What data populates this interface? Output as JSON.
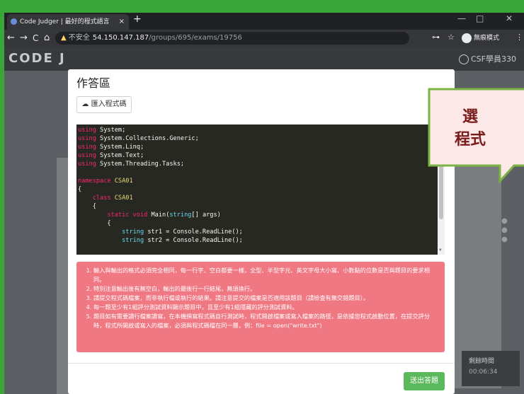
{
  "browser": {
    "tab_title": "Code Judger | 最好的程式語言",
    "tab_close": "×",
    "new_tab": "+",
    "win_min": "—",
    "win_max": "□",
    "win_close": "✕",
    "back": "←",
    "forward": "→",
    "reload": "C",
    "home": "⌂",
    "security_label": "不安全",
    "url_host": "54.150.147.187",
    "url_path": "/groups/695/exams/19756",
    "key_icon": "⊶",
    "star_icon": "☆",
    "incognito_label": "無痕模式",
    "menu_icon": "⋮"
  },
  "site": {
    "logo": "CODE J",
    "user": "CSF學員330"
  },
  "modal": {
    "title": "作答區",
    "import_button": "匯入程式碼",
    "submit_button": "送出答題"
  },
  "code_lines": [
    [
      {
        "t": "using",
        "c": "kw"
      },
      {
        "t": " System;",
        "c": ""
      }
    ],
    [
      {
        "t": "using",
        "c": "kw"
      },
      {
        "t": " System.Collections.Generic;",
        "c": ""
      }
    ],
    [
      {
        "t": "using",
        "c": "kw"
      },
      {
        "t": " System.Linq;",
        "c": ""
      }
    ],
    [
      {
        "t": "using",
        "c": "kw"
      },
      {
        "t": " System.Text;",
        "c": ""
      }
    ],
    [
      {
        "t": "using",
        "c": "kw"
      },
      {
        "t": " System.Threading.Tasks;",
        "c": ""
      }
    ],
    [],
    [
      {
        "t": "namespace",
        "c": "kw"
      },
      {
        "t": " CSA01",
        "c": "cls"
      }
    ],
    [
      {
        "t": "{",
        "c": ""
      }
    ],
    [
      {
        "t": "    class",
        "c": "kw"
      },
      {
        "t": " CSA01",
        "c": "cls"
      }
    ],
    [
      {
        "t": "    {",
        "c": ""
      }
    ],
    [
      {
        "t": "        static",
        "c": "kw"
      },
      {
        "t": " ",
        "c": ""
      },
      {
        "t": "void",
        "c": "kw"
      },
      {
        "t": " Main(",
        "c": ""
      },
      {
        "t": "string",
        "c": "ty"
      },
      {
        "t": "[] args)",
        "c": ""
      }
    ],
    [
      {
        "t": "        {",
        "c": ""
      }
    ],
    [
      {
        "t": "            ",
        "c": ""
      },
      {
        "t": "string",
        "c": "ty"
      },
      {
        "t": " str1 = Console.ReadLine();",
        "c": ""
      }
    ],
    [
      {
        "t": "            ",
        "c": ""
      },
      {
        "t": "string",
        "c": "ty"
      },
      {
        "t": " str2 = Console.ReadLine();",
        "c": ""
      }
    ]
  ],
  "notice_items": [
    "輸入與輸出的格式必須完全相同，每一行字、空白都要一樣，全型、半型字元、英文字母大小寫、小數點的位數是否與題目的要求相同。",
    "特別注意輸出後有無空白，輸出的最後行一行結尾，無須換行。",
    "請提交程式碼檔案，而非執行檔或執行的結果。請注意提交的檔案是否適用該題目（請檢查有無交錯題目）。",
    "每一題至少有1組評分測試資料顯示題目中，且至少有1組隱藏的評分測試資料。",
    "題目如有需要讀行檔案讀寫，在本機撰寫程式碼自行測試時，程式開啟檔案或寫入檔案的路徑，是依據您程式啟動位置，在提交評分時，程式所開啟或寫入的檔案，必須與程式碼檔在同一層，例：file = open(\"write.txt\")"
  ],
  "timer": {
    "label": "剩餘時間",
    "value": "00:06:34"
  },
  "callout": {
    "line1": "選",
    "line2": "程式",
    "bg": "#fde8e8",
    "border": "#7cb342",
    "text_color": "#7a1b1b"
  }
}
